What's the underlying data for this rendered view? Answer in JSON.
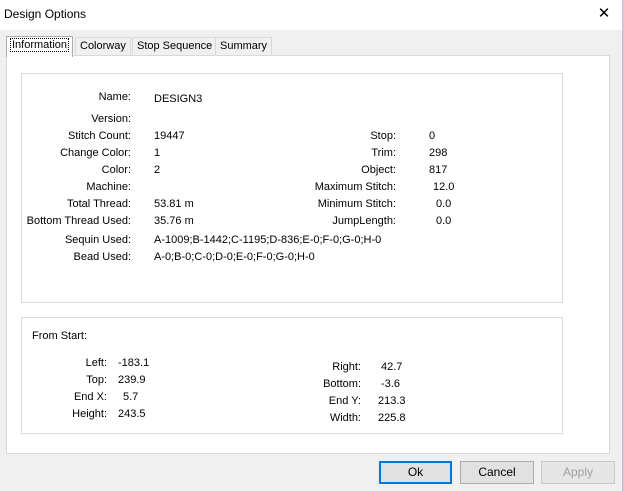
{
  "window": {
    "title": "Design Options",
    "close_glyph": "✕"
  },
  "tabs": [
    "Information",
    "Colorway",
    "Stop Sequence",
    "Summary"
  ],
  "info": {
    "left": [
      {
        "label": "Name:",
        "value": "DESIGN3"
      },
      {
        "label": "Version:",
        "value": ""
      },
      {
        "label": "Stitch Count:",
        "value": "19447"
      },
      {
        "label": "Change Color:",
        "value": "1"
      },
      {
        "label": "Color:",
        "value": "2"
      },
      {
        "label": "Machine:",
        "value": ""
      },
      {
        "label": "Total Thread:",
        "value": "53.81 m"
      },
      {
        "label": "Bottom Thread Used:",
        "value": "35.76 m"
      },
      {
        "label": "Sequin Used:",
        "value": "A-1009;B-1442;C-1195;D-836;E-0;F-0;G-0;H-0"
      },
      {
        "label": "Bead Used:",
        "value": "A-0;B-0;C-0;D-0;E-0;F-0;G-0;H-0"
      }
    ],
    "right": [
      {
        "label": "Stop:",
        "value": "0"
      },
      {
        "label": "Trim:",
        "value": "298"
      },
      {
        "label": "Object:",
        "value": "817"
      },
      {
        "label": "Maximum Stitch:",
        "value": "12.0"
      },
      {
        "label": "Minimum Stitch:",
        "value": "0.0"
      },
      {
        "label": "JumpLength:",
        "value": "0.0"
      }
    ]
  },
  "from_start": {
    "title": "From Start:",
    "left": [
      {
        "label": "Left:",
        "value": "-183.1"
      },
      {
        "label": "Top:",
        "value": "239.9"
      },
      {
        "label": "End X:",
        "value": "5.7"
      },
      {
        "label": "Height:",
        "value": "243.5"
      }
    ],
    "right": [
      {
        "label": "Right:",
        "value": "42.7"
      },
      {
        "label": "Bottom:",
        "value": "-3.6"
      },
      {
        "label": "End Y:",
        "value": "213.3"
      },
      {
        "label": "Width:",
        "value": "225.8"
      }
    ]
  },
  "buttons": {
    "ok": "Ok",
    "cancel": "Cancel",
    "apply": "Apply"
  }
}
